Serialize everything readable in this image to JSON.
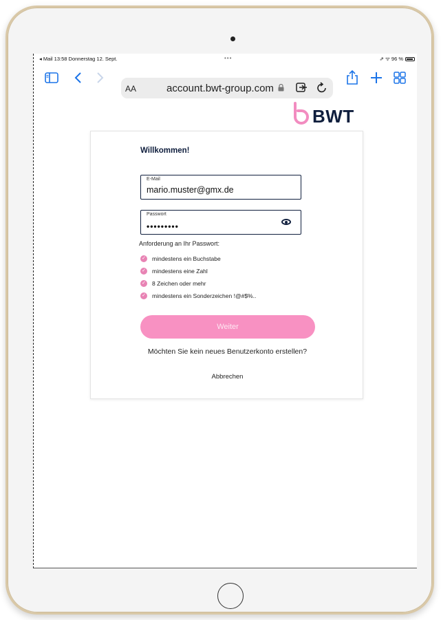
{
  "status_bar": {
    "left": "◂ Mail  13:58  Donnerstag 12. Sept.",
    "dots": "•••",
    "right": "⇗ ᯤ 96 %"
  },
  "browser": {
    "text_size_label": "AA",
    "url": "account.bwt-group.com"
  },
  "brand": {
    "name": "BWT",
    "accent": "#f891c2",
    "navy": "#0f1e3d"
  },
  "form": {
    "welcome": "Willkommen!",
    "email_label": "E-Mail",
    "email_value": "mario.muster@gmx.de",
    "password_label": "Passwort",
    "password_value": "•••••••••",
    "requirements_title": "Anforderung an Ihr Passwort:",
    "requirements": [
      "mindestens ein Buchstabe",
      "mindestens eine Zahl",
      "8 Zeichen oder mehr",
      "mindestens ein Sonderzeichen !@#$%.."
    ],
    "next_label": "Weiter",
    "no_account_text": "Möchten Sie kein neues Benutzerkonto erstellen?",
    "cancel_label": "Abbrechen"
  }
}
